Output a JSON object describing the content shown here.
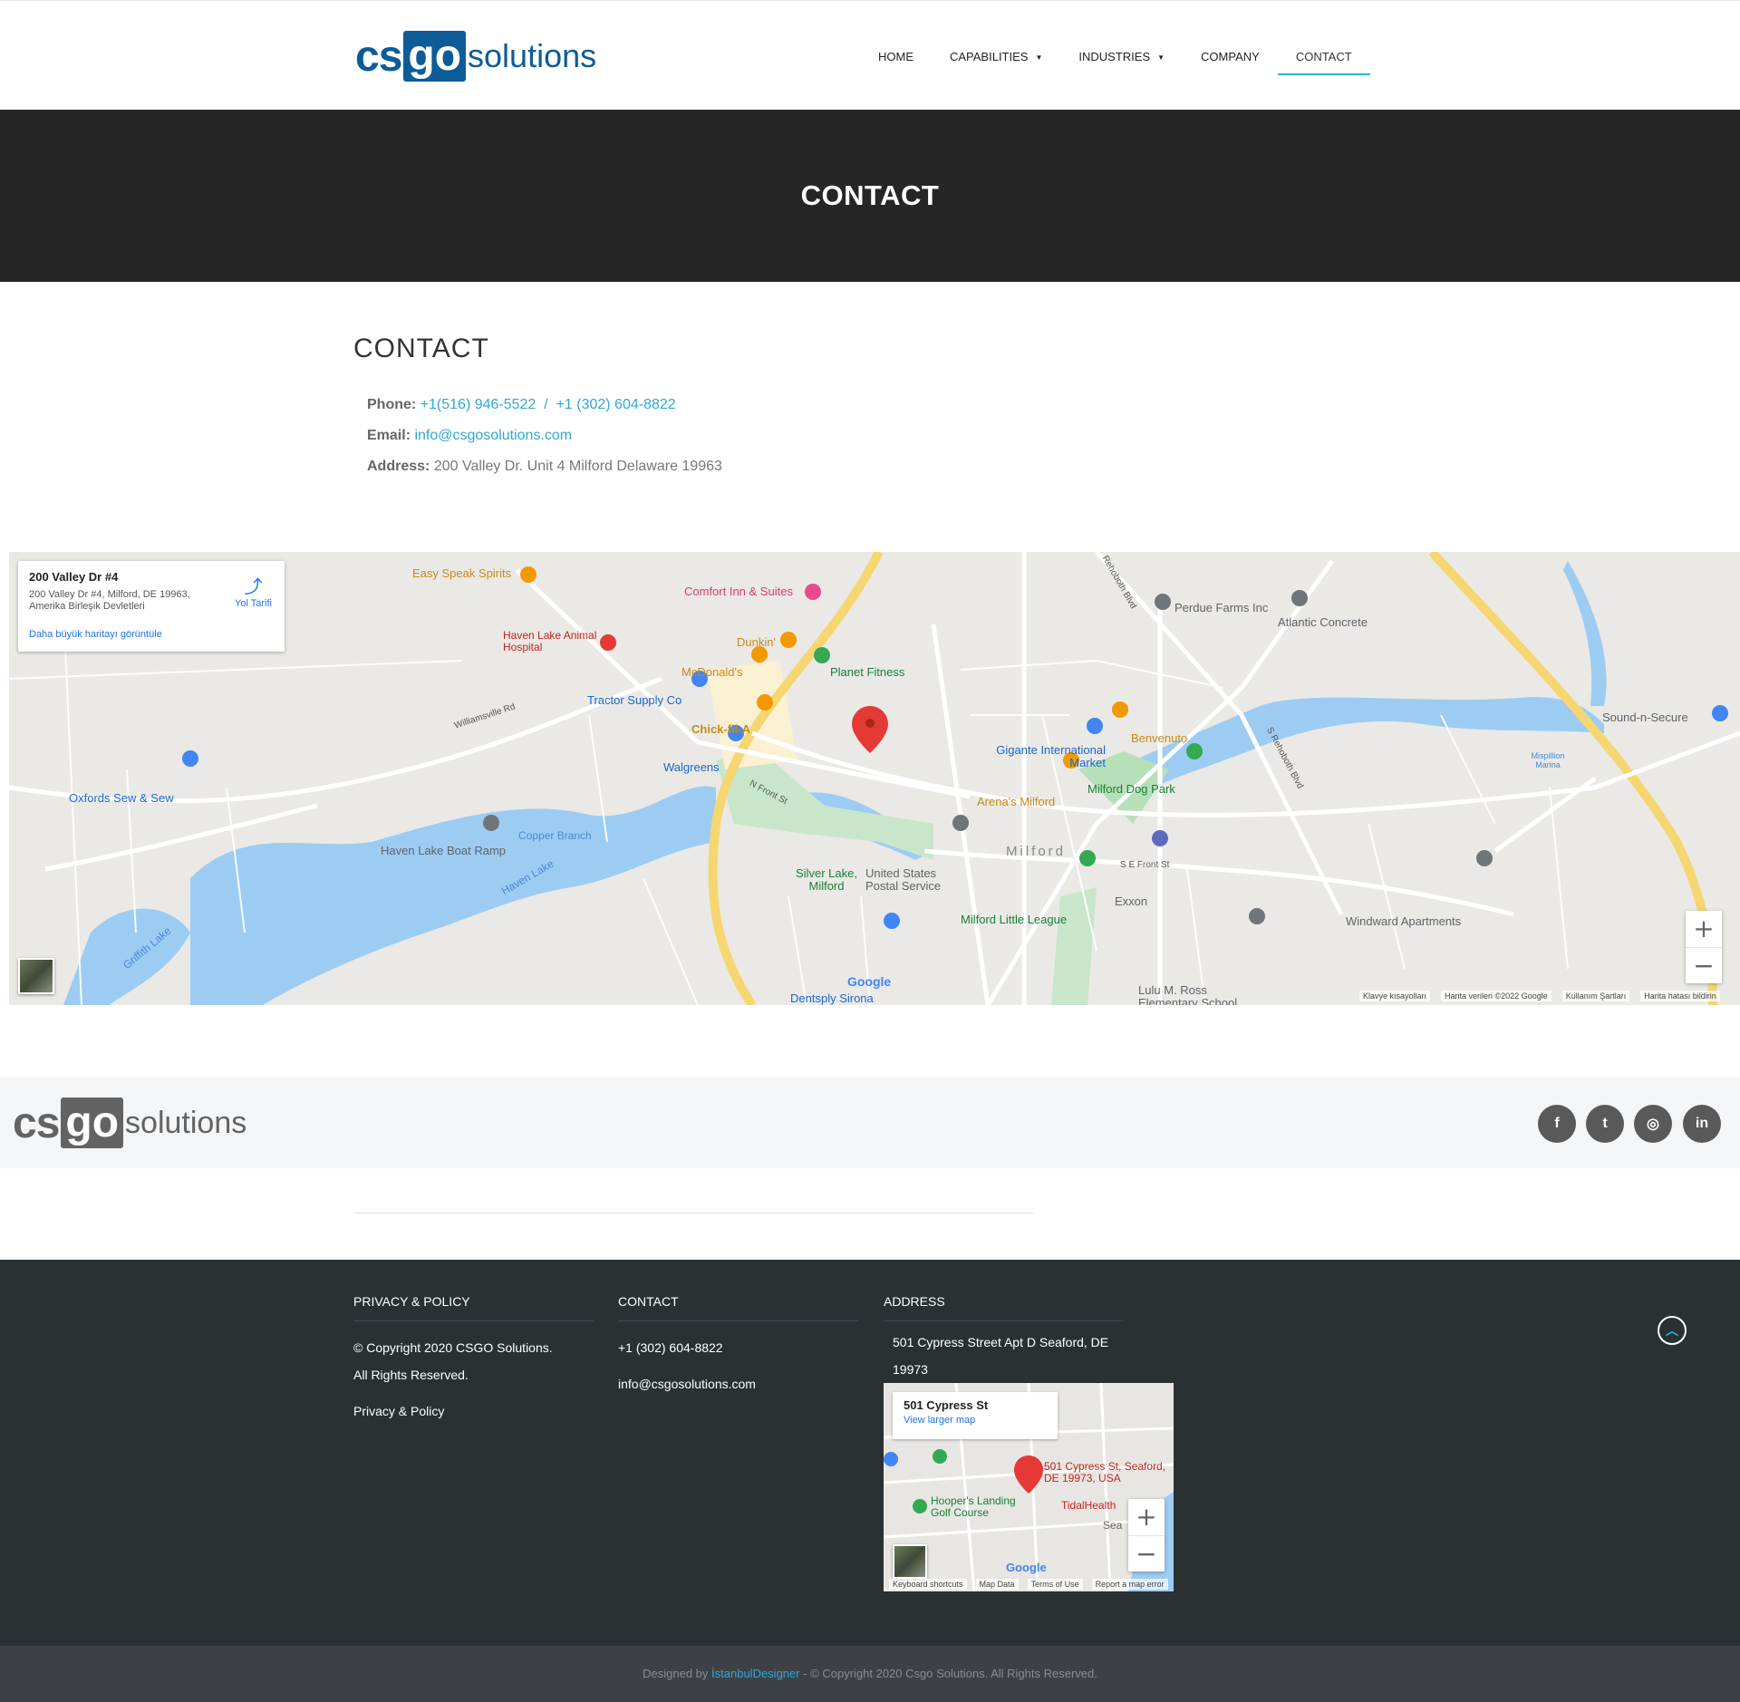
{
  "header": {
    "logo": {
      "cs": "cs",
      "go": "go",
      "solutions": "solutions"
    },
    "nav": [
      {
        "label": "HOME",
        "has_caret": false
      },
      {
        "label": "CAPABILITIES",
        "has_caret": true
      },
      {
        "label": "INDUSTRIES",
        "has_caret": true
      },
      {
        "label": "COMPANY",
        "has_caret": false
      },
      {
        "label": "CONTACT",
        "has_caret": false,
        "active": true
      }
    ],
    "caret": "▼"
  },
  "hero": {
    "title": "CONTACT"
  },
  "contact": {
    "title": "CONTACT",
    "phone_label": "Phone:",
    "phone_1": "+1(516) 946-5522",
    "phone_sep": "/",
    "phone_2": "+1 (302) 604-8822",
    "email_label": "Email:",
    "email": "info@csgosolutions.com",
    "address_label": "Address:",
    "address": "200 Valley Dr. Unit 4 Milford Delaware 19963"
  },
  "map": {
    "card_title": "200 Valley Dr #4",
    "card_address": "200 Valley Dr #4, Milford, DE 19963, Amerika Birleşik Devletleri",
    "card_link": "Daha büyük haritayı görüntüle",
    "directions_label": "Yol Tarifi",
    "labels": {
      "easy_speak": "Easy Speak Spirits",
      "comfort_inn": "Comfort Inn & Suites",
      "haven_lake_animal": "Haven Lake Animal Hospital",
      "dunkin": "Dunkin'",
      "mcdonalds": "McDonald's",
      "planet_fitness": "Planet Fitness",
      "tractor_supply": "Tractor Supply Co",
      "chick_fil_a": "Chick-fil-A",
      "walgreens": "Walgreens",
      "perdue_farms": "Perdue Farms Inc",
      "atlantic_concrete": "Atlantic Concrete",
      "sound_n_secure": "Sound-n-Secure",
      "benvenuto": "Benvenuto",
      "gigante": "Gigante International Market",
      "arenas": "Arena's Milford",
      "dog_park": "Milford Dog Park",
      "oxfords": "Oxfords Sew & Sew",
      "copper_branch": "Copper Branch",
      "haven_lake_boat": "Haven Lake Boat Ramp",
      "haven_lake": "Haven Lake",
      "silver_lake": "Silver Lake, Milford",
      "usps": "United States Postal Service",
      "milford": "Milford",
      "exxon": "Exxon",
      "little_league": "Milford Little League",
      "windward": "Windward Apartments",
      "lulu_ross": "Lulu M. Ross Elementary School",
      "dentsply": "Dentsply Sirona",
      "griffith_lake": "Griffith Lake",
      "mispillion": "Mispillion Marina",
      "williamsville_rd": "Williamsville Rd",
      "n_front_st": "N Front St",
      "s_rehoboth_blvd": "S Rehoboth Blvd",
      "s_e_front_st": "S E Front St",
      "rehoboth_blvd": "Rehoboth Blvd"
    },
    "footer": {
      "shortcuts": "Klavye kısayolları",
      "data": "Harita verileri ©2022 Google",
      "terms": "Kullanım Şartları",
      "report": "Harita hatası bildirin"
    },
    "google": "Google",
    "zoom_in": "+",
    "zoom_out": "−"
  },
  "footer_band": {
    "logo": {
      "cs": "cs",
      "go": "go",
      "solutions": "solutions"
    },
    "social": [
      {
        "name": "facebook-icon",
        "glyph": "f"
      },
      {
        "name": "twitter-icon",
        "glyph": "t"
      },
      {
        "name": "instagram-icon",
        "glyph": "◎"
      },
      {
        "name": "linkedin-icon",
        "glyph": "in"
      }
    ]
  },
  "footer": {
    "col1": {
      "title": "PRIVACY & POLICY",
      "copyright": "© Copyright  2020 CSGO Solutions.",
      "rights": "All Rights Reserved.",
      "link": "Privacy & Policy"
    },
    "col2": {
      "title": "CONTACT",
      "phone": "+1 (302) 604-8822",
      "email": "info@csgosolutions.com"
    },
    "col3": {
      "title": "ADDRESS",
      "address_line1": "501 Cypress Street Apt D Seaford, DE",
      "address_line2": "19973"
    },
    "mini_map": {
      "card_title": "501 Cypress St",
      "card_link": "View larger map",
      "pin_label_1": "501 Cypress St, Seaford,",
      "pin_label_2": "DE 19973, USA",
      "hoopers_1": "Hooper's Landing",
      "hoopers_2": "Golf Course",
      "tidal": "TidalHealth",
      "sea": "Sea",
      "google": "Google",
      "foot_shortcuts": "Keyboard shortcuts",
      "foot_data": "Map Data",
      "foot_terms": "Terms of Use",
      "foot_report": "Report a map error"
    },
    "to_top": "︿"
  },
  "bottom_bar": {
    "prefix": "Designed by",
    "brand": "İstanbulDesigner",
    "suffix": "- © Copyright 2020 Csgo Solutions. All Rights Reserved."
  },
  "colors": {
    "brand_blue": "#0d5c98",
    "accent": "#2bb3d8",
    "hero_bg": "#262626",
    "footer_bg": "#2b3033",
    "bottom_bg": "#3d4145"
  }
}
